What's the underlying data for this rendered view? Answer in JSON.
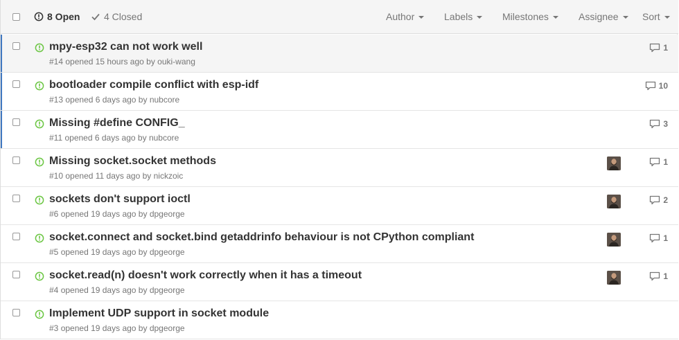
{
  "header": {
    "open_label": "8 Open",
    "closed_label": "4 Closed",
    "filters": [
      "Author",
      "Labels",
      "Milestones",
      "Assignee",
      "Sort"
    ]
  },
  "issues": [
    {
      "title": "mpy-esp32 can not work well",
      "number": "#14",
      "opened": "opened 15 hours ago by",
      "author": "ouki-wang",
      "comments": "1",
      "assignee": false,
      "unread": true,
      "highlighted": true
    },
    {
      "title": "bootloader compile conflict with esp-idf",
      "number": "#13",
      "opened": "opened 6 days ago by",
      "author": "nubcore",
      "comments": "10",
      "assignee": false,
      "unread": true,
      "highlighted": false
    },
    {
      "title": "Missing #define CONFIG_",
      "number": "#11",
      "opened": "opened 6 days ago by",
      "author": "nubcore",
      "comments": "3",
      "assignee": false,
      "unread": true,
      "highlighted": false
    },
    {
      "title": "Missing socket.socket methods",
      "number": "#10",
      "opened": "opened 11 days ago by",
      "author": "nickzoic",
      "comments": "1",
      "assignee": true,
      "unread": false,
      "highlighted": false
    },
    {
      "title": "sockets don't support ioctl",
      "number": "#6",
      "opened": "opened 19 days ago by",
      "author": "dpgeorge",
      "comments": "2",
      "assignee": true,
      "unread": false,
      "highlighted": false
    },
    {
      "title": "socket.connect and socket.bind getaddrinfo behaviour is not CPython compliant",
      "number": "#5",
      "opened": "opened 19 days ago by",
      "author": "dpgeorge",
      "comments": "1",
      "assignee": true,
      "unread": false,
      "highlighted": false
    },
    {
      "title": "socket.read(n) doesn't work correctly when it has a timeout",
      "number": "#4",
      "opened": "opened 19 days ago by",
      "author": "dpgeorge",
      "comments": "1",
      "assignee": true,
      "unread": false,
      "highlighted": false
    },
    {
      "title": "Implement UDP support in socket module",
      "number": "#3",
      "opened": "opened 19 days ago by",
      "author": "dpgeorge",
      "comments": "",
      "assignee": false,
      "unread": false,
      "highlighted": false
    }
  ],
  "colors": {
    "open_icon": "#6cc644",
    "unread_bar": "#4078c0",
    "muted": "#767676"
  }
}
